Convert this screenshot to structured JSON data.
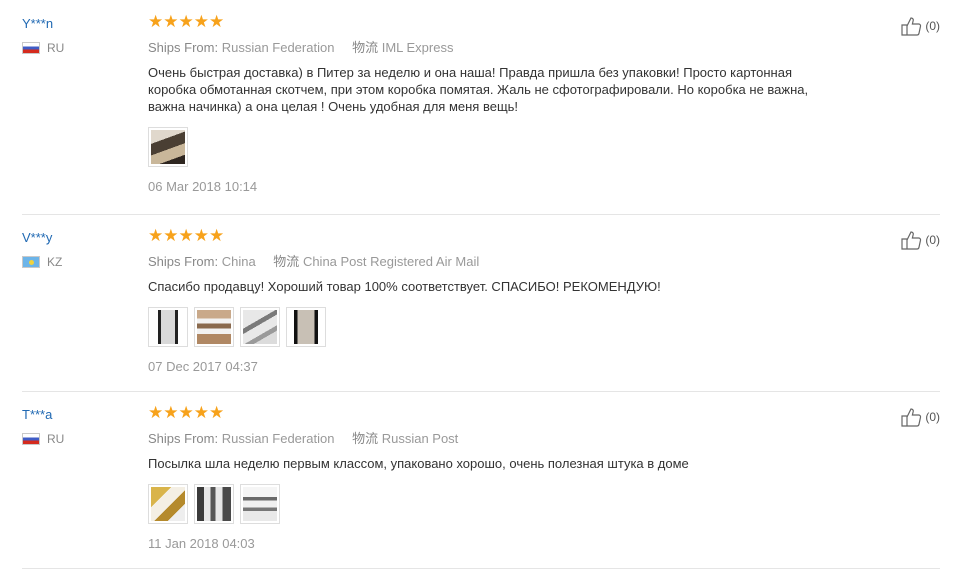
{
  "reviews": [
    {
      "user": "Y***n",
      "country_code": "RU",
      "stars": "★★★★★",
      "ships_from_label": "Ships From:",
      "ships_from": "Russian Federation",
      "logistics_label": "物流",
      "logistics": "IML Express",
      "text": "Очень быстрая доставка) в Питер за неделю и она наша! Правда пришла без упаковки! Просто картонная коробка обмотанная скотчем, при этом коробка помятая. Жаль не сфотографировали. Но коробка не важна, важна начинка) а она целая ! Очень удобная для меня вещь!",
      "date": "06 Mar 2018 10:14",
      "helpful": "(0)"
    },
    {
      "user": "V***y",
      "country_code": "KZ",
      "stars": "★★★★★",
      "ships_from_label": "Ships From:",
      "ships_from": "China",
      "logistics_label": "物流",
      "logistics": "China Post Registered Air Mail",
      "text": "Спасибо продавцу! Хороший товар 100% соответствует. СПАСИБО! РЕКОМЕНДУЮ!",
      "date": "07 Dec 2017 04:37",
      "helpful": "(0)"
    },
    {
      "user": "T***a",
      "country_code": "RU",
      "stars": "★★★★★",
      "ships_from_label": "Ships From:",
      "ships_from": "Russian Federation",
      "logistics_label": "物流",
      "logistics": "Russian Post",
      "text": "Посылка шла неделю первым классом, упаковано хорошо, очень полезная штука в доме",
      "date": "11 Jan 2018 04:03",
      "helpful": "(0)"
    }
  ],
  "colors": {
    "star": "#f7a21b",
    "username": "#2069b3",
    "muted": "#999999"
  }
}
